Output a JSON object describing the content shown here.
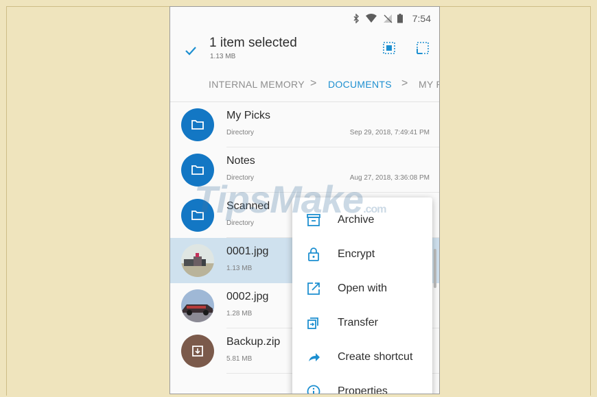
{
  "status_bar": {
    "time": "7:54"
  },
  "app_bar": {
    "title": "1 item selected",
    "subtitle": "1.13 MB"
  },
  "breadcrumb": [
    "INTERNAL MEMORY",
    "DOCUMENTS",
    "MY P"
  ],
  "files": [
    {
      "name": "My Picks",
      "meta": "Directory",
      "date": "Sep 29, 2018, 7:49:41 PM",
      "kind": "folder"
    },
    {
      "name": "Notes",
      "meta": "Directory",
      "date": "Aug 27, 2018, 3:36:08 PM",
      "kind": "folder"
    },
    {
      "name": "Scanned",
      "meta": "Directory",
      "date": "",
      "kind": "folder"
    },
    {
      "name": "0001.jpg",
      "meta": "1.13 MB",
      "date": "",
      "kind": "image",
      "selected": true
    },
    {
      "name": "0002.jpg",
      "meta": "1.28 MB",
      "date": "",
      "kind": "image"
    },
    {
      "name": "Backup.zip",
      "meta": "5.81 MB",
      "date": "",
      "kind": "zip"
    }
  ],
  "context_menu": [
    {
      "label": "Archive",
      "icon": "archive-icon"
    },
    {
      "label": "Encrypt",
      "icon": "lock-icon"
    },
    {
      "label": "Open with",
      "icon": "open-external-icon"
    },
    {
      "label": "Transfer",
      "icon": "transfer-icon"
    },
    {
      "label": "Create shortcut",
      "icon": "shortcut-arrow-icon"
    },
    {
      "label": "Properties",
      "icon": "info-icon"
    }
  ],
  "watermark": {
    "text": "TipsMake",
    "suffix": ".com"
  },
  "colors": {
    "accent": "#1d8fd0",
    "folder": "#1377c4",
    "zip": "#7b5a4b",
    "selected_row": "#cfe1ee",
    "background": "#efe4bd"
  }
}
